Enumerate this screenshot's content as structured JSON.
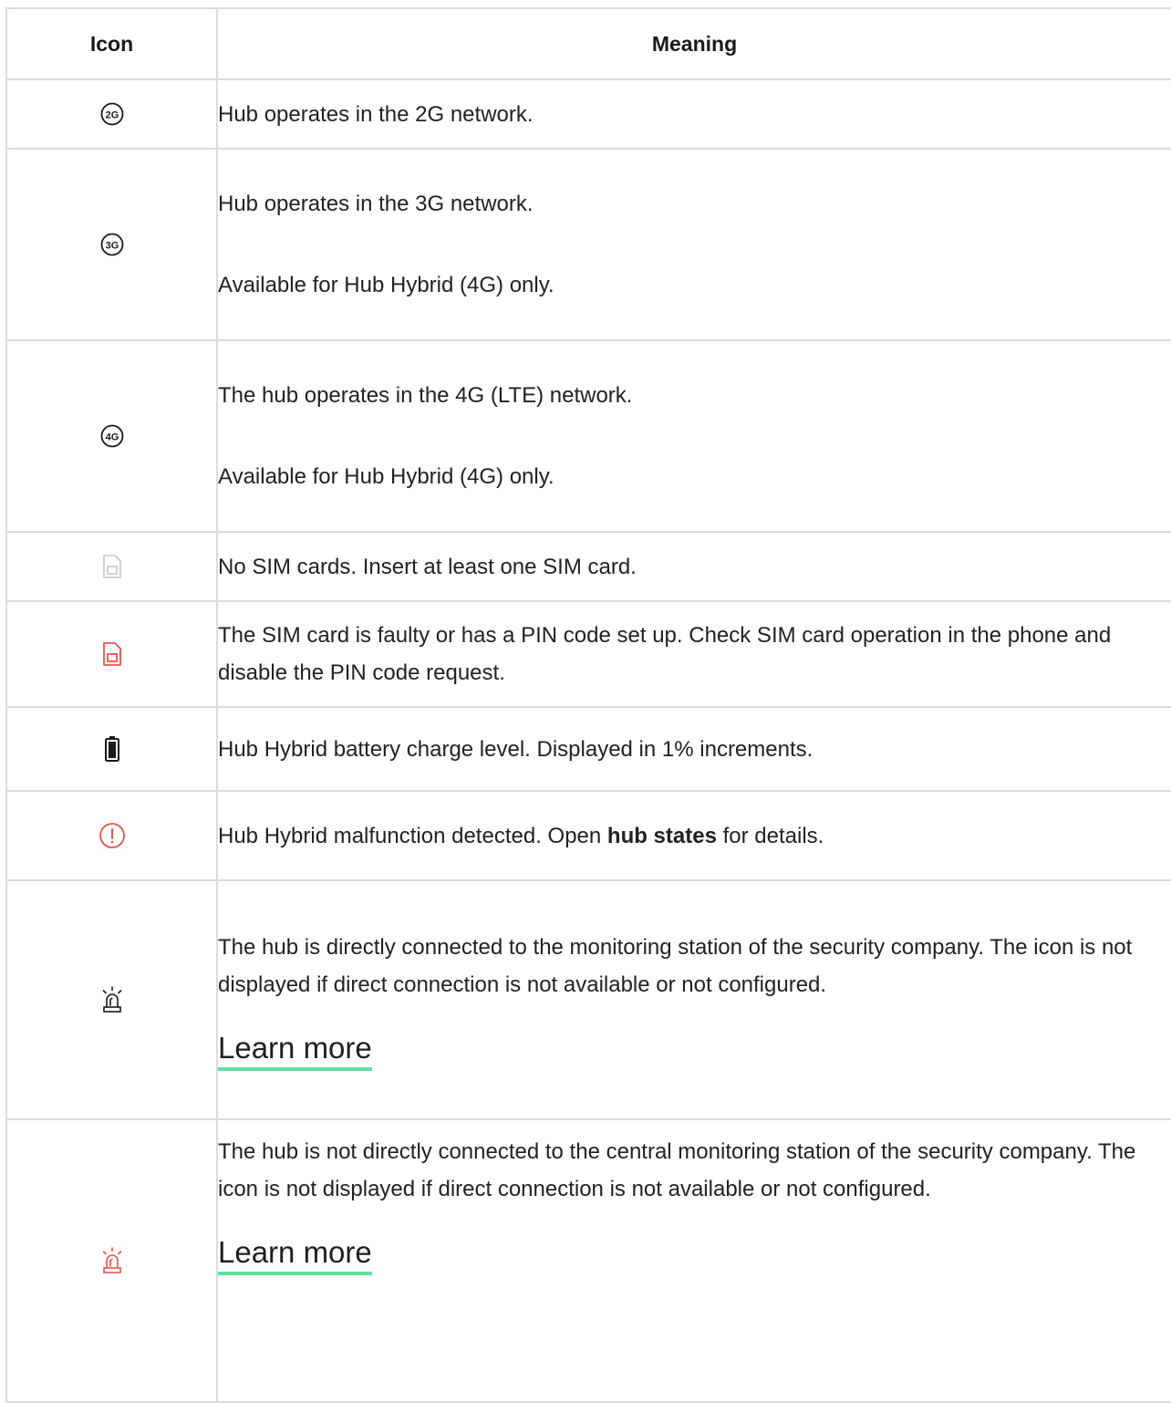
{
  "table": {
    "headers": {
      "icon": "Icon",
      "meaning": "Meaning"
    },
    "rows": [
      {
        "icon": "2g-network-icon",
        "text": "Hub operates in the 2G network."
      },
      {
        "icon": "3g-network-icon",
        "text": "Hub operates in the 3G network.",
        "note": "Available for Hub Hybrid (4G) only."
      },
      {
        "icon": "4g-network-icon",
        "text": "The hub operates in the 4G (LTE) network.",
        "note": "Available for Hub Hybrid (4G) only."
      },
      {
        "icon": "no-sim-icon",
        "text": "No SIM cards. Insert at least one SIM card."
      },
      {
        "icon": "sim-error-icon",
        "text": "The SIM card is faulty or has a PIN code set up. Check SIM card operation in the phone and disable the PIN code request."
      },
      {
        "icon": "battery-icon",
        "text": "Hub Hybrid battery charge level. Displayed in 1% increments."
      },
      {
        "icon": "malfunction-icon",
        "text_before": "Hub Hybrid malfunction detected. Open ",
        "text_bold": "hub states",
        "text_after": " for details."
      },
      {
        "icon": "siren-connected-icon",
        "text": "The hub is directly connected to the monitoring station of the security company. The icon is not displayed if direct connection is not available or not configured.",
        "link": "Learn more"
      },
      {
        "icon": "siren-disconnected-icon",
        "text": "The hub is not directly connected to the central monitoring station of the security company. The icon is not displayed if direct connection is not available or not configured.",
        "link": "Learn more"
      }
    ]
  },
  "colors": {
    "border": "#dcdcdc",
    "text": "#222222",
    "alert_red": "#e8554e",
    "icon_gray": "#c6c6c6",
    "link_underline": "#5fe1a1"
  }
}
